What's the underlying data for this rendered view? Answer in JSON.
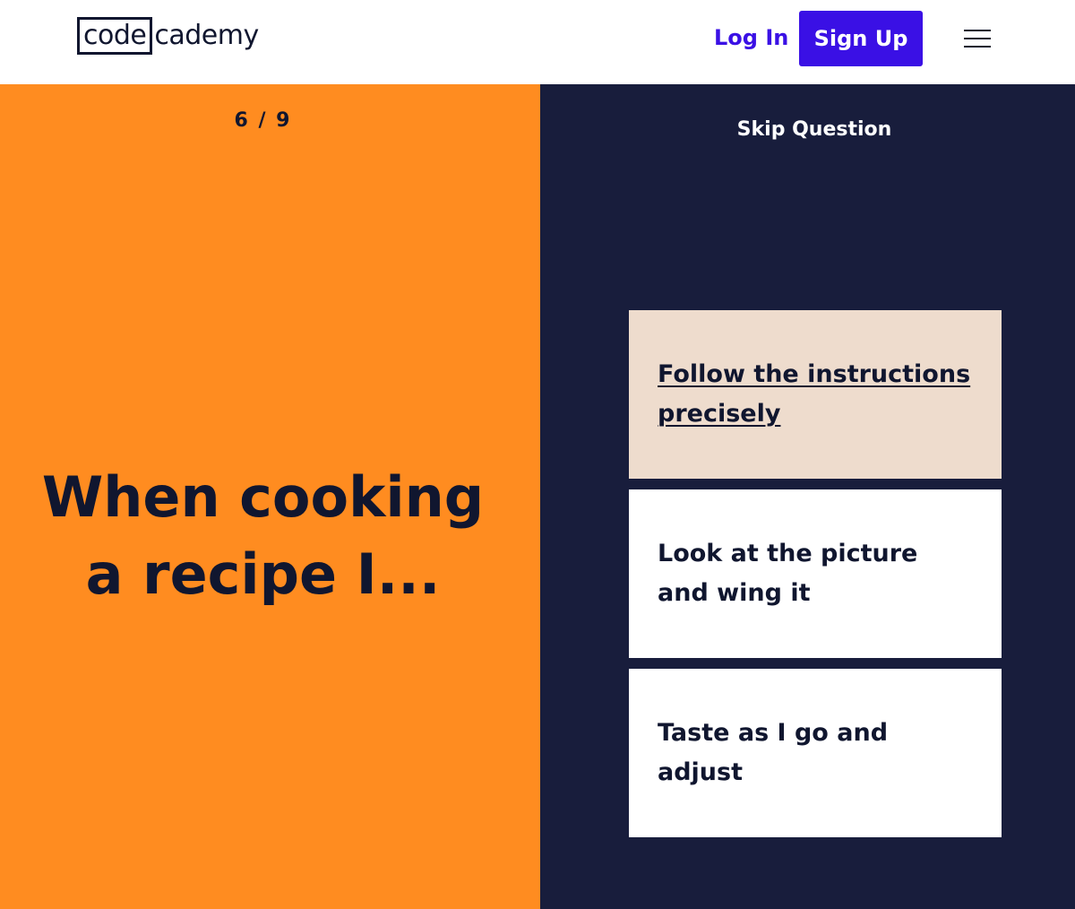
{
  "header": {
    "logo": {
      "part1": "code",
      "part2": "cademy"
    },
    "login_label": "Log In",
    "signup_label": "Sign Up",
    "menu_icon": "hamburger-menu-icon"
  },
  "quiz": {
    "progress": "6 / 9",
    "question": "When cooking a recipe I...",
    "skip_label": "Skip Question",
    "answers": [
      {
        "label": "Follow the instructions precisely",
        "selected": true
      },
      {
        "label": "Look at the picture and wing it",
        "selected": false
      },
      {
        "label": "Taste as I go and adjust",
        "selected": false
      }
    ]
  },
  "colors": {
    "brand_blue": "#3a10e5",
    "navy": "#10162f",
    "orange": "#ff8c20",
    "dark_panel": "#181d3c",
    "selected_answer": "#eedccd"
  }
}
